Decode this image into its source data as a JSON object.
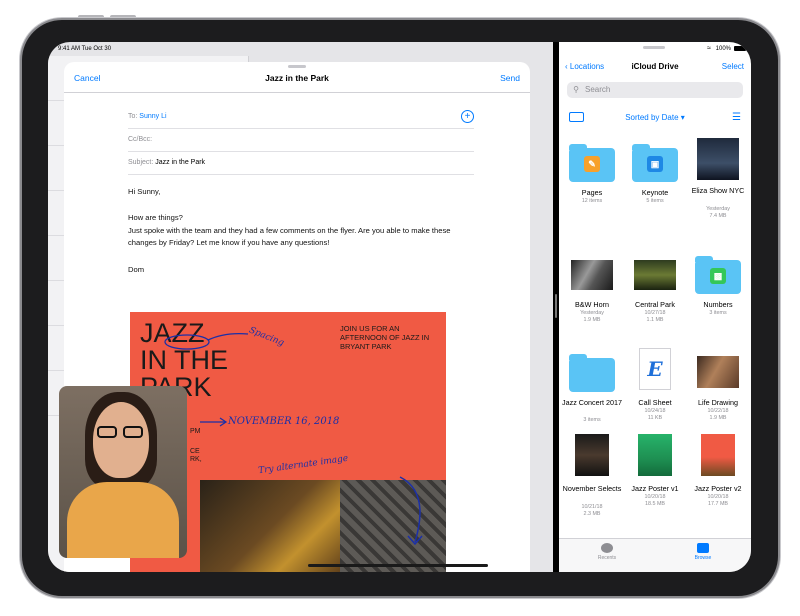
{
  "status": {
    "time": "9:41 AM",
    "date": "Tue Oct 30",
    "battery": "100%"
  },
  "compose": {
    "cancel": "Cancel",
    "title": "Jazz in the Park",
    "send": "Send",
    "to_label": "To:",
    "to_value": "Sunny Li",
    "cc_label": "Cc/Bcc:",
    "subject_label": "Subject:",
    "subject_value": "Jazz in the Park",
    "greeting": "Hi Sunny,",
    "line1": "How are things?",
    "line2": "Just spoke with the team and they had a few comments on the flyer. Are you able to make these changes by Friday? Let me know if you have any questions!",
    "signoff": "Dom"
  },
  "poster": {
    "jazz1": "JAZZ",
    "jazz2": "IN THE",
    "jazz3": "PARK",
    "join": "JOIN US FOR AN AFTERNOON OF JAZZ IN BRYANT PARK",
    "pm": "PM",
    "ce": "CE",
    "rk": "RK,",
    "note_spacing": "Spacing",
    "note_date": "NOVEMBER 16, 2018",
    "note_image": "Try alternate image"
  },
  "files": {
    "locations": "Locations",
    "title": "iCloud Drive",
    "select": "Select",
    "search_placeholder": "Search",
    "sort": "Sorted by Date",
    "items": [
      {
        "name": "Pages",
        "meta1": "12 items",
        "meta2": "",
        "meta3": ""
      },
      {
        "name": "Keynote",
        "meta1": "5 items",
        "meta2": "",
        "meta3": ""
      },
      {
        "name": "Eliza Show NYC",
        "meta1": "Yesterday",
        "meta2": "7.4 MB",
        "meta3": ""
      },
      {
        "name": "B&W Horn",
        "meta1": "Yesterday",
        "meta2": "1.9 MB",
        "meta3": ""
      },
      {
        "name": "Central Park",
        "meta1": "10/27/18",
        "meta2": "1.1 MB",
        "meta3": ""
      },
      {
        "name": "Numbers",
        "meta1": "3 items",
        "meta2": "",
        "meta3": ""
      },
      {
        "name": "Jazz Concert 2017",
        "meta1": "3 items",
        "meta2": "",
        "meta3": ""
      },
      {
        "name": "Call Sheet",
        "meta1": "10/24/18",
        "meta2": "11 KB",
        "meta3": ""
      },
      {
        "name": "Life Drawing",
        "meta1": "10/22/18",
        "meta2": "1.9 MB",
        "meta3": ""
      },
      {
        "name": "November Selects",
        "meta1": "10/21/18",
        "meta2": "2.3 MB",
        "meta3": ""
      },
      {
        "name": "Jazz Poster v1",
        "meta1": "10/20/18",
        "meta2": "18.5 MB",
        "meta3": ""
      },
      {
        "name": "Jazz Poster v2",
        "meta1": "10/20/18",
        "meta2": "17.7 MB",
        "meta3": ""
      }
    ],
    "tabs": {
      "recents": "Recents",
      "browse": "Browse"
    }
  },
  "colors": {
    "accent": "#007aff",
    "poster": "#f05a44",
    "folder": "#5ac4f5",
    "ink": "#1b2fa8"
  }
}
